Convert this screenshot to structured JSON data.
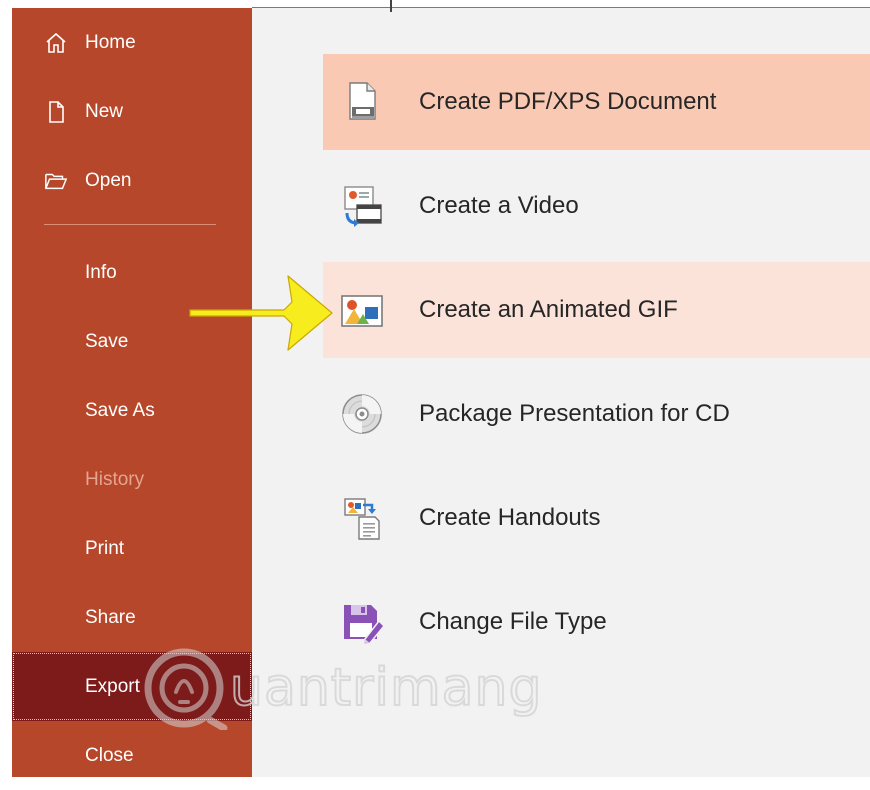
{
  "sidebar": {
    "items": [
      {
        "label": "Home",
        "icon": "home-icon"
      },
      {
        "label": "New",
        "icon": "new-document-icon"
      },
      {
        "label": "Open",
        "icon": "open-folder-icon"
      },
      {
        "label": "Info"
      },
      {
        "label": "Save"
      },
      {
        "label": "Save As"
      },
      {
        "label": "History",
        "disabled": true
      },
      {
        "label": "Print"
      },
      {
        "label": "Share"
      },
      {
        "label": "Export",
        "selected": true
      },
      {
        "label": "Close"
      }
    ]
  },
  "export_options": [
    {
      "label": "Create PDF/XPS Document",
      "icon": "pdf-document-icon",
      "state": "highlighted"
    },
    {
      "label": "Create a Video",
      "icon": "video-icon"
    },
    {
      "label": "Create an Animated GIF",
      "icon": "animated-gif-icon",
      "state": "hover"
    },
    {
      "label": "Package Presentation for CD",
      "icon": "cd-icon"
    },
    {
      "label": "Create Handouts",
      "icon": "handouts-icon"
    },
    {
      "label": "Change File Type",
      "icon": "change-file-type-icon"
    }
  ],
  "watermark": {
    "text": "uantrimang"
  },
  "colors": {
    "sidebar": "#b7472a",
    "sidebar_selected": "#7d1a1a",
    "highlight_strong": "#f9c9b4",
    "highlight_light": "#fbe3da",
    "arrow": "#f7ec1d"
  }
}
